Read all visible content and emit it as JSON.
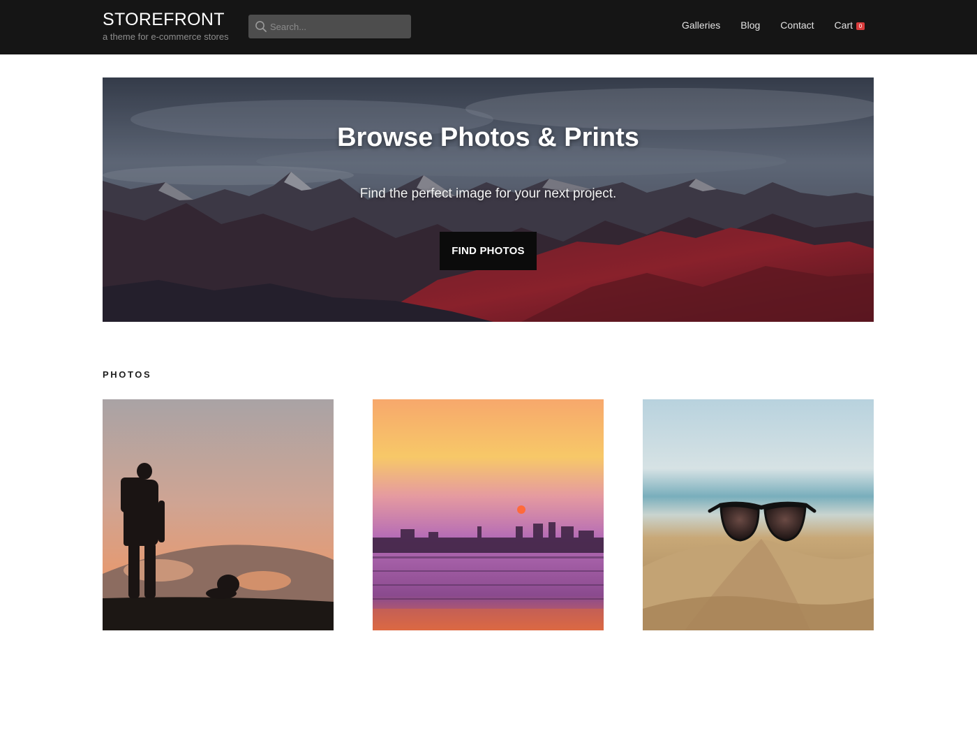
{
  "header": {
    "brand_title": "STOREFRONT",
    "brand_tagline": "a theme for e-commerce stores",
    "search_placeholder": "Search...",
    "nav": [
      {
        "label": "Galleries"
      },
      {
        "label": "Blog"
      },
      {
        "label": "Contact"
      },
      {
        "label": "Cart"
      }
    ],
    "cart_count": "0"
  },
  "hero": {
    "title": "Browse Photos & Prints",
    "subtitle": "Find the perfect image for your next project.",
    "button_label": "FIND PHOTOS",
    "image": "mountain-range-at-dusk"
  },
  "photos_section": {
    "heading": "PHOTOS",
    "items": [
      {
        "image": "hiker-silhouette-sunset"
      },
      {
        "image": "purple-sunset-over-water"
      },
      {
        "image": "sunglasses-on-beach-sand"
      }
    ]
  },
  "colors": {
    "header_bg": "#151515",
    "search_bg": "#4d4d4d",
    "cart_badge": "#d93c3c",
    "button_bg": "#0b0b0b"
  }
}
